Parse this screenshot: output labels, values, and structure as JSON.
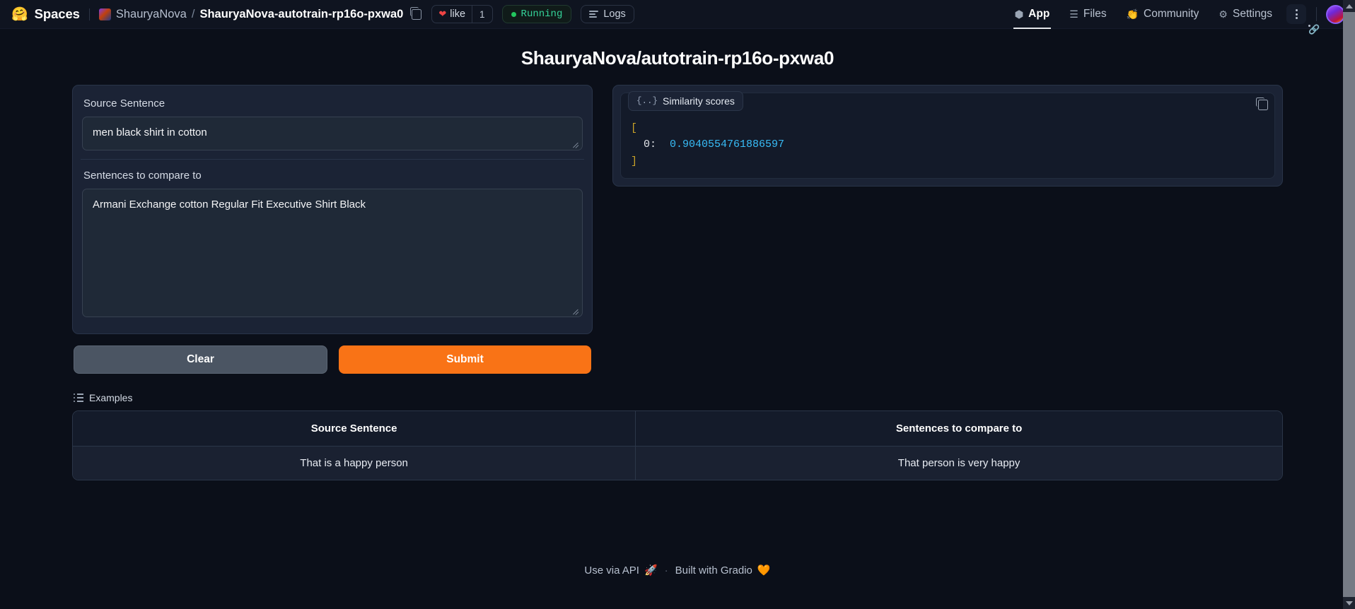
{
  "header": {
    "brand_emoji": "🤗",
    "brand": "Spaces",
    "repo_owner": "ShauryaNova",
    "repo_separator": "/",
    "repo_name": "ShauryaNova-autotrain-rp16o-pxwa0",
    "copy_path_icon": "copy-icon",
    "like_label": "like",
    "like_count": "1",
    "status": "Running",
    "logs": "Logs",
    "nav": [
      {
        "label": "App",
        "icon": "cube-icon",
        "glyph": "⬢",
        "active": true
      },
      {
        "label": "Files",
        "icon": "files-icon",
        "glyph": "☰",
        "active": false
      },
      {
        "label": "Community",
        "icon": "clap-emoji",
        "glyph": "👏",
        "active": false
      },
      {
        "label": "Settings",
        "icon": "gear-icon",
        "glyph": "⚙",
        "active": false
      }
    ],
    "kebab_icon": "more-options-icon",
    "avatar": "user-avatar"
  },
  "page": {
    "title": "ShauryaNova/autotrain-rp16o-pxwa0"
  },
  "form": {
    "source_label": "Source Sentence",
    "source_value": "men black shirt in cotton",
    "source_placeholder": "",
    "compare_label": "Sentences to compare to",
    "compare_value": "Armani Exchange cotton Regular Fit Executive Shirt Black",
    "compare_placeholder": "",
    "clear_label": "Clear",
    "submit_label": "Submit"
  },
  "output": {
    "chip_label": "Similarity scores",
    "chip_icon": "json-braces-icon",
    "braces": "{..}",
    "copy_icon": "copy-icon",
    "open_bracket": "[",
    "close_bracket": "]",
    "rows": [
      {
        "key": "0:",
        "value": "0.9040554761886597"
      }
    ]
  },
  "examples": {
    "label": "Examples",
    "icon": "list-icon",
    "columns": [
      "Source Sentence",
      "Sentences to compare to"
    ],
    "rows": [
      [
        "That is a happy person",
        "That person is very happy"
      ]
    ]
  },
  "footer": {
    "api_label": "Use via API",
    "api_icon": "🚀",
    "separator": "·",
    "gradio_label": "Built with Gradio",
    "gradio_icon": "🧡"
  },
  "colors": {
    "accent_orange": "#f97316",
    "status_green": "#34d399",
    "json_number": "#38bdf8",
    "page_bg": "#0b0f19",
    "panel_bg": "#1b2335"
  }
}
